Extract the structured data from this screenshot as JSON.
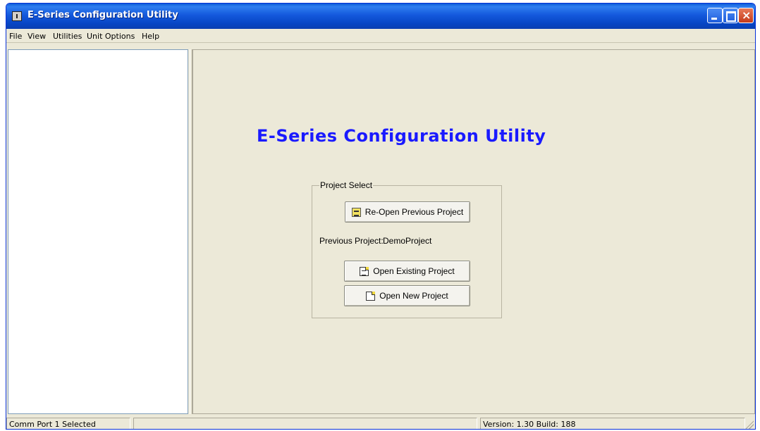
{
  "window": {
    "title": "E-Series Configuration Utility"
  },
  "menu": [
    {
      "label": "File"
    },
    {
      "label": "View"
    },
    {
      "label": "Utilities"
    },
    {
      "label": "Unit Options"
    },
    {
      "label": "Help"
    }
  ],
  "main": {
    "heading": "E-Series Configuration Utility",
    "project_select": {
      "legend": "Project Select",
      "reopen_label": "Re-Open Previous Project",
      "previous_label": "Previous Project:",
      "previous_value": "DemoProject",
      "open_existing_label": "Open Existing Project",
      "open_new_label": "Open New Project"
    }
  },
  "status": {
    "port": "Comm Port 1 Selected",
    "middle": "",
    "version": "Version: 1.30 Build: 188"
  },
  "colors": {
    "titlebar": "#0a5bd6",
    "heading": "#1a1aff",
    "face": "#ece9d8"
  },
  "icons": {
    "app": "app-icon",
    "reopen": "reopen-project-icon",
    "existing": "open-document-icon",
    "new": "new-document-icon"
  }
}
